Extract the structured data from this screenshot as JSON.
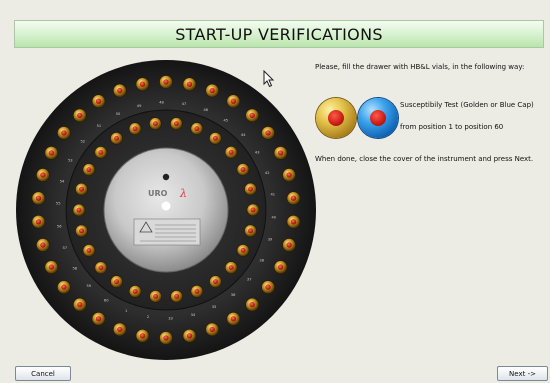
{
  "header": {
    "title": "START-UP VERIFICATIONS"
  },
  "instructions": {
    "intro": "Please, fill the drawer with HB&L vials, in the following way:",
    "test_label": "Susceptibily Test (Golden or Blue Cap)",
    "position_text": "from position 1 to position 60",
    "done_text": "When done, close the cover of the instrument and press Next."
  },
  "carousel": {
    "logo_text": "URO",
    "position_labels": [
      "1",
      "2",
      "33",
      "34",
      "35",
      "36",
      "37",
      "38",
      "39",
      "40",
      "41",
      "42",
      "43",
      "44",
      "45",
      "46",
      "47",
      "48",
      "49",
      "50",
      "51",
      "52",
      "53",
      "54",
      "55",
      "56",
      "57",
      "58",
      "59",
      "60"
    ]
  },
  "caps": [
    {
      "name": "golden cap",
      "color": "#d4af37"
    },
    {
      "name": "blue cap",
      "color": "#1f7fd6"
    }
  ],
  "buttons": {
    "cancel": "Cancel",
    "next": "Next ->"
  }
}
